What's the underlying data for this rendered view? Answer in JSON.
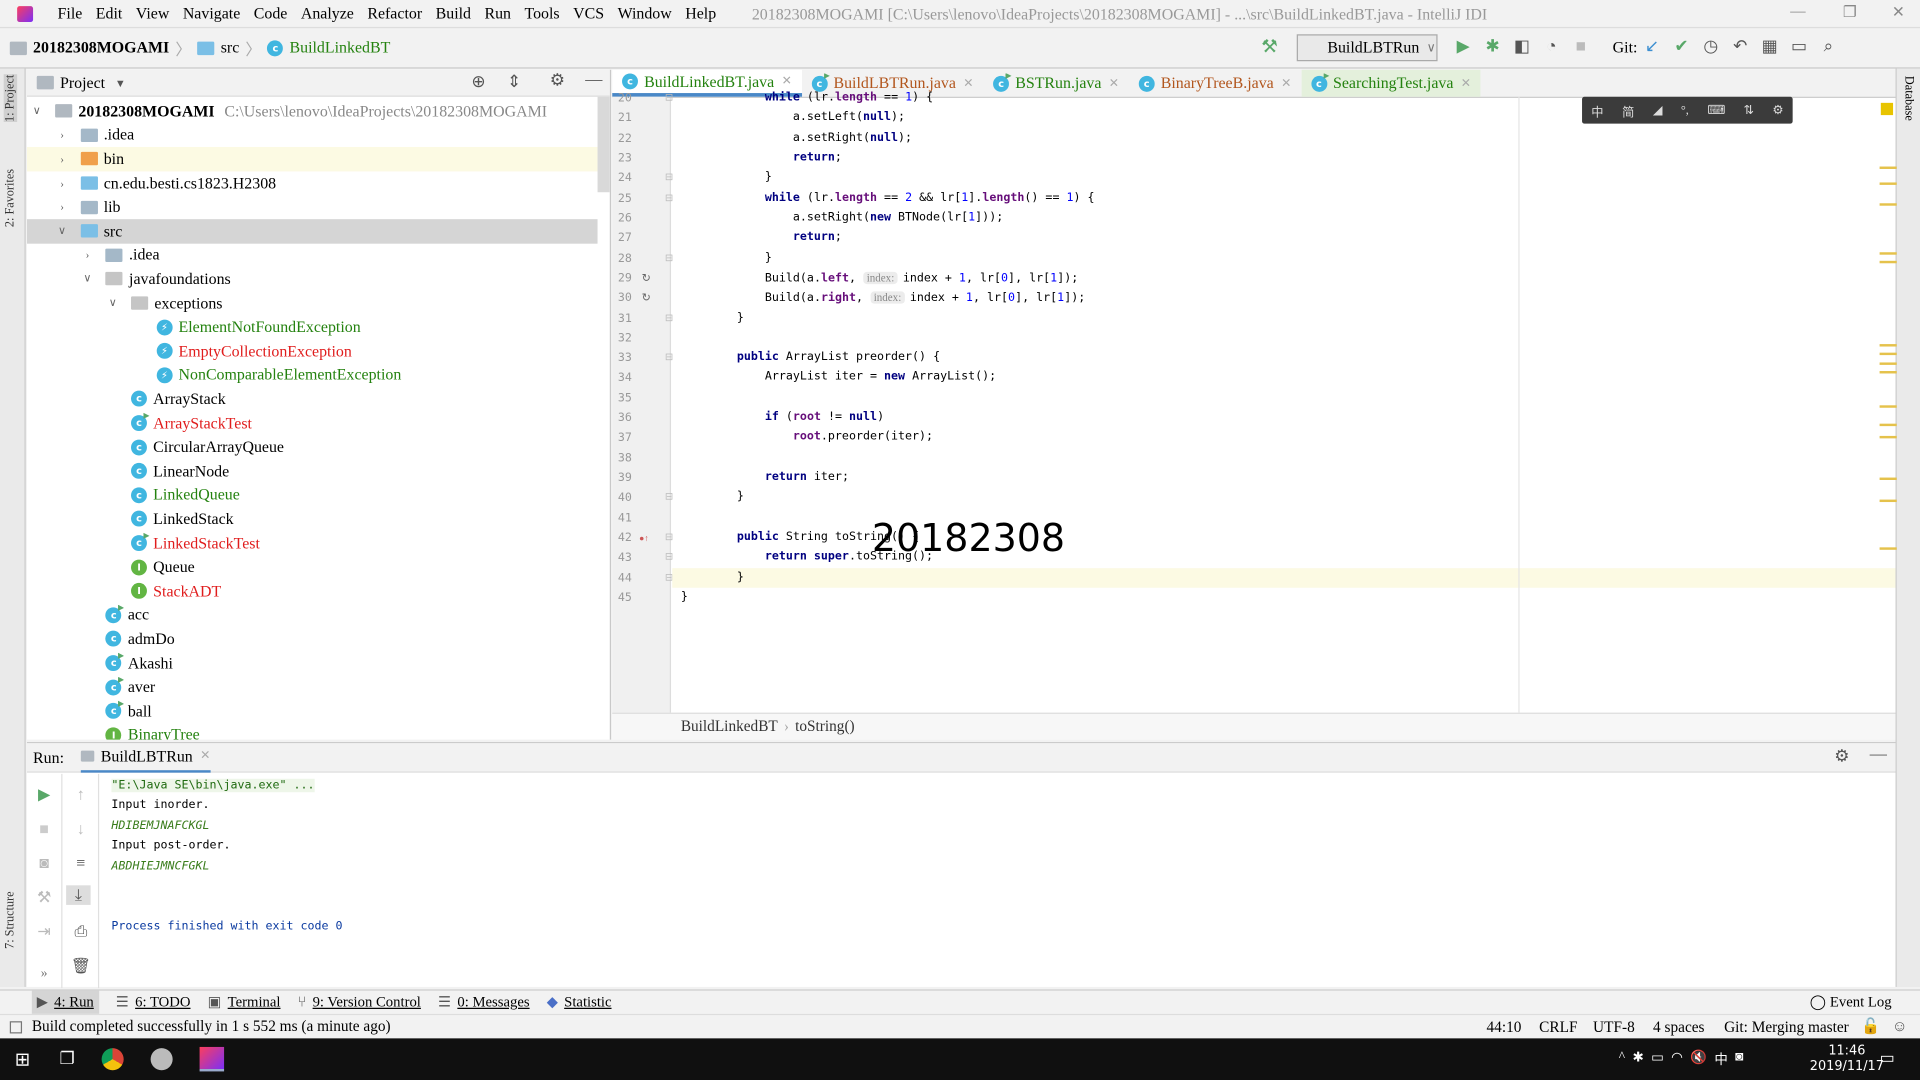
{
  "window": {
    "title": "20182308MOGAMI [C:\\Users\\lenovo\\IdeaProjects\\20182308MOGAMI] - ...\\src\\BuildLinkedBT.java - IntelliJ IDI",
    "controls": [
      "minimize",
      "restore",
      "close"
    ]
  },
  "menu": [
    "File",
    "Edit",
    "View",
    "Navigate",
    "Code",
    "Analyze",
    "Refactor",
    "Build",
    "Run",
    "Tools",
    "VCS",
    "Window",
    "Help"
  ],
  "breadcrumb": [
    "20182308MOGAMI",
    "src",
    "BuildLinkedBT"
  ],
  "toolbar": {
    "run_config": "BuildLBTRun",
    "git_label": "Git:"
  },
  "left_strip": [
    "1: Project",
    "2: Favorites",
    "7: Structure"
  ],
  "right_strip": [
    "Database"
  ],
  "project": {
    "title": "Project",
    "tree": [
      {
        "label": "20182308MOGAMI",
        "path": "C:\\Users\\lenovo\\IdeaProjects\\20182308MOGAMI",
        "depth": 0,
        "icon": "module-folder",
        "expanded": true,
        "bold": true,
        "color": "normal"
      },
      {
        "label": ".idea",
        "depth": 1,
        "icon": "folder",
        "expanded": false,
        "color": "normal"
      },
      {
        "label": "bin",
        "depth": 1,
        "icon": "folder-orange",
        "expanded": false,
        "color": "normal",
        "highlight": true
      },
      {
        "label": "cn.edu.besti.cs1823.H2308",
        "depth": 1,
        "icon": "folder-blue",
        "expanded": false,
        "color": "normal"
      },
      {
        "label": "lib",
        "depth": 1,
        "icon": "folder",
        "expanded": false,
        "color": "normal"
      },
      {
        "label": "src",
        "depth": 1,
        "icon": "folder-blue",
        "expanded": true,
        "color": "normal",
        "selected": true
      },
      {
        "label": ".idea",
        "depth": 2,
        "icon": "folder",
        "expanded": false,
        "color": "normal"
      },
      {
        "label": "javafoundations",
        "depth": 2,
        "icon": "package",
        "expanded": true,
        "color": "normal"
      },
      {
        "label": "exceptions",
        "depth": 3,
        "icon": "package",
        "expanded": true,
        "color": "normal"
      },
      {
        "label": "ElementNotFoundException",
        "depth": 4,
        "icon": "exception",
        "color": "green"
      },
      {
        "label": "EmptyCollectionException",
        "depth": 4,
        "icon": "exception",
        "color": "red"
      },
      {
        "label": "NonComparableElementException",
        "depth": 4,
        "icon": "exception",
        "color": "green"
      },
      {
        "label": "ArrayStack",
        "depth": 3,
        "icon": "class",
        "color": "normal"
      },
      {
        "label": "ArrayStackTest",
        "depth": 3,
        "icon": "class-run",
        "color": "red"
      },
      {
        "label": "CircularArrayQueue",
        "depth": 3,
        "icon": "class",
        "color": "normal"
      },
      {
        "label": "LinearNode",
        "depth": 3,
        "icon": "class",
        "color": "normal"
      },
      {
        "label": "LinkedQueue",
        "depth": 3,
        "icon": "class",
        "color": "green"
      },
      {
        "label": "LinkedStack",
        "depth": 3,
        "icon": "class",
        "color": "normal"
      },
      {
        "label": "LinkedStackTest",
        "depth": 3,
        "icon": "class-run",
        "color": "red"
      },
      {
        "label": "Queue",
        "depth": 3,
        "icon": "interface",
        "color": "normal"
      },
      {
        "label": "StackADT",
        "depth": 3,
        "icon": "interface",
        "color": "red"
      },
      {
        "label": "acc",
        "depth": 2,
        "icon": "class-run",
        "color": "normal"
      },
      {
        "label": "admDo",
        "depth": 2,
        "icon": "class",
        "color": "normal"
      },
      {
        "label": "Akashi",
        "depth": 2,
        "icon": "class-run",
        "color": "normal"
      },
      {
        "label": "aver",
        "depth": 2,
        "icon": "class-run",
        "color": "normal"
      },
      {
        "label": "ball",
        "depth": 2,
        "icon": "class-run",
        "color": "normal"
      },
      {
        "label": "BinaryTree",
        "depth": 2,
        "icon": "interface",
        "color": "green"
      }
    ]
  },
  "tabs": [
    {
      "label": "BuildLinkedBT.java",
      "icon": "class",
      "color": "green",
      "active": true
    },
    {
      "label": "BuildLBTRun.java",
      "icon": "class-run",
      "color": "orange"
    },
    {
      "label": "BSTRun.java",
      "icon": "class-run",
      "color": "green"
    },
    {
      "label": "BinaryTreeB.java",
      "icon": "class",
      "color": "orange"
    },
    {
      "label": "SearchingTest.java",
      "icon": "class-run",
      "color": "green",
      "tinted": true
    }
  ],
  "code": [
    {
      "n": 20,
      "text": "            while (lr.length == 1) {"
    },
    {
      "n": 21,
      "text": "                a.setLeft(null);"
    },
    {
      "n": 22,
      "text": "                a.setRight(null);"
    },
    {
      "n": 23,
      "text": "                return;"
    },
    {
      "n": 24,
      "text": "            }"
    },
    {
      "n": 25,
      "text": "            while (lr.length == 2 && lr[1].length() == 1) {"
    },
    {
      "n": 26,
      "text": "                a.setRight(new BTNode(lr[1]));"
    },
    {
      "n": 27,
      "text": "                return;"
    },
    {
      "n": 28,
      "text": "            }"
    },
    {
      "n": 29,
      "text": "            Build(a.left, ",
      "hint": "index:",
      "after": "index + 1, lr[0], lr[1]);"
    },
    {
      "n": 30,
      "text": "            Build(a.right, ",
      "hint": "index:",
      "after": "index + 1, lr[0], lr[1]);"
    },
    {
      "n": 31,
      "text": "        }"
    },
    {
      "n": 32,
      "text": ""
    },
    {
      "n": 33,
      "text": "        public ArrayList preorder() {"
    },
    {
      "n": 34,
      "text": "            ArrayList iter = new ArrayList();"
    },
    {
      "n": 35,
      "text": ""
    },
    {
      "n": 36,
      "text": "            if (root != null)"
    },
    {
      "n": 37,
      "text": "                root.preorder(iter);"
    },
    {
      "n": 38,
      "text": ""
    },
    {
      "n": 39,
      "text": "            return iter;"
    },
    {
      "n": 40,
      "text": "        }"
    },
    {
      "n": 41,
      "text": ""
    },
    {
      "n": 42,
      "text": "        public String toString() {"
    },
    {
      "n": 43,
      "text": "            return super.toString();"
    },
    {
      "n": 44,
      "text": "        }",
      "current": true
    },
    {
      "n": 45,
      "text": "}"
    }
  ],
  "overlay_text": "20182308",
  "ime_toolbar": [
    "中",
    "简",
    "◢",
    "°,",
    "⌨",
    "⇅",
    "⚙"
  ],
  "editor_breadcrumb": [
    "BuildLinkedBT",
    "toString()"
  ],
  "run": {
    "label": "Run:",
    "tab": "BuildLBTRun",
    "console": [
      {
        "text": "\"E:\\Java SE\\bin\\java.exe\" ...",
        "type": "cmd"
      },
      {
        "text": "Input inorder.",
        "type": "normal"
      },
      {
        "text": "HDIBEMJNAFCKGL",
        "type": "out"
      },
      {
        "text": "Input post-order.",
        "type": "normal"
      },
      {
        "text": "ABDHIEJMNCFGKL",
        "type": "out"
      },
      {
        "text": "",
        "type": "normal"
      },
      {
        "text": "",
        "type": "normal"
      },
      {
        "text": "Process finished with exit code 0",
        "type": "exit"
      }
    ]
  },
  "tool_windows": [
    "4: Run",
    "6: TODO",
    "Terminal",
    "9: Version Control",
    "0: Messages",
    "Statistic"
  ],
  "event_log": "Event Log",
  "status": {
    "message": "Build completed successfully in 1 s 552 ms (a minute ago)",
    "position": "44:10",
    "line_sep": "CRLF",
    "encoding": "UTF-8",
    "indent": "4 spaces",
    "git": "Git: Merging master"
  },
  "taskbar": {
    "time": "11:46",
    "date": "2019/11/17",
    "tray": [
      "^",
      "bluetooth",
      "battery",
      "wifi",
      "volume-muted",
      "中",
      "ime"
    ]
  },
  "colors": {
    "green": "#24820f",
    "red": "#e01c1c",
    "orange": "#b2561d",
    "accent": "#4a88c7",
    "selection": "#d5d5d5"
  }
}
